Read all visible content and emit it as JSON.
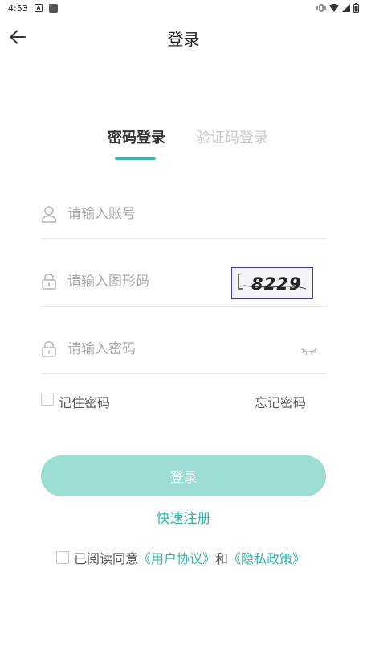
{
  "status_bar": {
    "time": "4:53",
    "icons": [
      "notification-a-icon",
      "app-icon",
      "vibrate-icon",
      "wifi-icon",
      "signal-icon",
      "battery-icon"
    ]
  },
  "header": {
    "title": "登录",
    "back_icon": "arrow-left-icon"
  },
  "tabs": [
    {
      "label": "密码登录",
      "active": true
    },
    {
      "label": "验证码登录",
      "active": false
    }
  ],
  "form": {
    "account_placeholder": "请输入账号",
    "captcha_placeholder": "请输入图形码",
    "captcha_text": "8229",
    "password_placeholder": "请输入密码"
  },
  "remember": {
    "label": "记住密码",
    "forgot_label": "忘记密码"
  },
  "login_button": "登录",
  "register_link": "快速注册",
  "agreement": {
    "prefix": "已阅读同意",
    "user_agreement": "《用户协议》",
    "and": "和",
    "privacy_policy": "《隐私政策》"
  },
  "colors": {
    "accent": "#2fb6a5",
    "button_disabled": "#9dddd4"
  }
}
